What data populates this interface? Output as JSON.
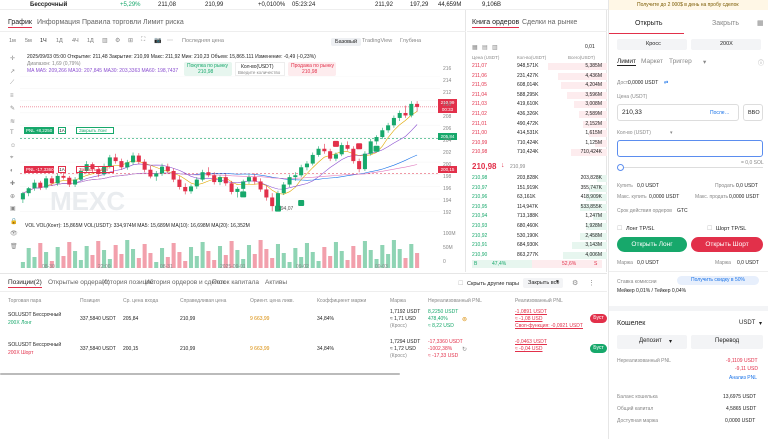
{
  "topbar": {
    "pair": "Бессрочный",
    "pct": "+5,29%",
    "price1": "211,08",
    "price2": "210,99",
    "pct2": "+0,0100%",
    "time": "05:23:24",
    "v1": "211,92",
    "v2": "197,29",
    "v3": "44,659M",
    "v4": "9,106B",
    "promo": "Получите до 2 000$ в день на пробу сделок"
  },
  "chart": {
    "tabs": [
      "График",
      "Информация",
      "Правила торговли",
      "Лимит риска"
    ],
    "intervals": [
      "1м",
      "5м",
      "1Ч",
      "1Д",
      "4Ч",
      "1Д"
    ],
    "depth_label": "Последняя цена",
    "views": [
      "Базовый",
      "TradingView",
      "Глубина"
    ],
    "ohlc": "2025/09/03 05:00  Открытие: 211,48  Закрытие: 210,99  Макс: 211,92  Мин: 210,23  Объем: 15,865.111  Изменение: -0,49 (-0,23%)",
    "range": "Диапазон: 1,69 (0,79%)",
    "ma": "MA  MA5: 209,266  MA10: 207,845  MA30: 203,3363  MA60: 198,7437",
    "buy_market": "Покупка по рынку",
    "qty": "Кол-во(USDT)",
    "qty_ph": "Введите количество",
    "sell_market": "Продажа по рынку",
    "buy_price": "210,98",
    "sell_price": "210,98",
    "pnl_long": "PNL +8,2250",
    "lots_long": "1A",
    "close_long": "Закрыть Лонг",
    "pnl_short": "PNL -17,3360",
    "close_short": "Закрыть Шорт",
    "watermark": "MEXC",
    "low_label": "194,07",
    "vol": "VOL  VOL(Конт): 15,865M  VOL(USDT): 334,974M  MA5: 15,689M  MA(10): 16,698M  MA(20): 16,352M",
    "x_ticks": [
      "08-30",
      "22:00",
      "08-31",
      "2025-09-01",
      "09-02",
      "09-03"
    ],
    "y_ticks": [
      "216",
      "214",
      "212",
      "210",
      "208",
      "206",
      "204",
      "202",
      "200",
      "198",
      "196",
      "194",
      "192"
    ],
    "price_tag": "210,99",
    "price_tag2": "00:33",
    "tag_green": "205,84",
    "tag_red": "200,15",
    "vol_ticks": [
      "100M",
      "50M",
      "0"
    ]
  },
  "chart_data": {
    "type": "candlestick",
    "candles": [
      [
        196,
        197.2,
        195.4,
        197
      ],
      [
        197,
        198,
        196.5,
        197.8
      ],
      [
        197.8,
        199.2,
        197.4,
        198.7
      ],
      [
        198.7,
        199,
        197.5,
        197.9
      ],
      [
        197.9,
        199.8,
        197.6,
        199.4
      ],
      [
        199.4,
        199.8,
        198.2,
        198.6
      ],
      [
        198.6,
        200.2,
        198.2,
        199.8
      ],
      [
        199.8,
        200.4,
        199.2,
        199.5
      ],
      [
        199.5,
        199.8,
        198,
        198.4
      ],
      [
        198.4,
        199.6,
        198,
        199.2
      ],
      [
        199.2,
        201,
        199,
        200.6
      ],
      [
        200.6,
        202.2,
        200.2,
        201.7
      ],
      [
        201.7,
        202,
        200.4,
        200.9
      ],
      [
        200.9,
        201.4,
        199.6,
        200.1
      ],
      [
        200.1,
        201.8,
        199.8,
        201.4
      ],
      [
        201.4,
        203.2,
        201,
        202.8
      ],
      [
        202.8,
        203.4,
        201.8,
        202.2
      ],
      [
        202.2,
        202.6,
        200.8,
        201.2
      ],
      [
        201.2,
        202.4,
        200.8,
        202
      ],
      [
        202,
        203.6,
        201.6,
        203.1
      ],
      [
        203.1,
        203.5,
        201.7,
        202.1
      ],
      [
        202.1,
        202.5,
        200.4,
        200.8
      ],
      [
        200.8,
        201.4,
        199.4,
        199.7
      ],
      [
        199.7,
        200.6,
        199,
        200.2
      ],
      [
        200.2,
        201.8,
        199.8,
        201.3
      ],
      [
        201.3,
        201.8,
        200.2,
        200.6
      ],
      [
        200.6,
        201,
        198.8,
        199.2
      ],
      [
        199.2,
        199.8,
        197.6,
        198
      ],
      [
        198,
        198.6,
        196.8,
        197.3
      ],
      [
        197.3,
        198.4,
        196.9,
        198.1
      ],
      [
        198.1,
        199.6,
        197.7,
        199.2
      ],
      [
        199.2,
        200.8,
        198.9,
        200.4
      ],
      [
        200.4,
        201.2,
        199.6,
        199.9
      ],
      [
        199.9,
        200.4,
        198.4,
        198.8
      ],
      [
        198.8,
        199.9,
        198.3,
        199.6
      ],
      [
        199.6,
        200.1,
        198.2,
        198.6
      ],
      [
        198.6,
        199,
        196.8,
        197.2
      ],
      [
        197.2,
        198,
        196.3,
        197.7
      ],
      [
        197.7,
        199.2,
        197.3,
        198.9
      ],
      [
        198.9,
        200,
        198.5,
        199.6
      ],
      [
        199.6,
        200.2,
        198.4,
        198.9
      ],
      [
        198.9,
        199.4,
        197.2,
        197.6
      ],
      [
        197.6,
        198.2,
        195.8,
        196.3
      ],
      [
        196.3,
        197,
        194.07,
        194.9
      ],
      [
        194.9,
        197.4,
        194.5,
        197
      ],
      [
        197,
        198.8,
        196.7,
        198.4
      ],
      [
        198.4,
        200,
        198,
        199.6
      ],
      [
        199.6,
        200.4,
        199,
        199.9
      ],
      [
        199.9,
        201.6,
        199.6,
        201.2
      ],
      [
        201.2,
        202.2,
        200.7,
        201.8
      ],
      [
        201.8,
        203.6,
        201.5,
        203.2
      ],
      [
        203.2,
        204.6,
        202.9,
        204.2
      ],
      [
        204.2,
        205,
        203.4,
        203.8
      ],
      [
        203.8,
        204.2,
        202.2,
        202.6
      ],
      [
        202.6,
        203.6,
        202.2,
        203.3
      ],
      [
        203.3,
        205.2,
        203,
        204.8
      ],
      [
        204.8,
        205.4,
        203.9,
        204.2
      ],
      [
        204.2,
        204.6,
        201.8,
        202.2
      ],
      [
        202.2,
        202.6,
        200.4,
        200.9
      ],
      [
        200.9,
        203.8,
        200.6,
        203.4
      ],
      [
        203.4,
        205.8,
        203.1,
        205.4
      ],
      [
        205.4,
        206.4,
        204.9,
        206.1
      ],
      [
        206.1,
        207.6,
        205.8,
        207.2
      ],
      [
        207.2,
        208.4,
        206.8,
        208
      ],
      [
        208,
        209.6,
        207.6,
        209.2
      ],
      [
        209.2,
        210.4,
        208.7,
        210
      ],
      [
        210,
        211.2,
        209.2,
        209.6
      ],
      [
        209.6,
        211.92,
        209.3,
        211.48
      ],
      [
        211.48,
        211.92,
        210.23,
        210.99
      ]
    ],
    "y_range": [
      192,
      216
    ],
    "x_labels": [
      "08-30",
      "22:00",
      "08-31",
      "2025-09-01",
      "09-02",
      "09-03"
    ],
    "volume_axis_range": [
      0,
      100
    ]
  },
  "orderbook": {
    "tabs": [
      "Книга ордеров",
      "Сделки на рынке"
    ],
    "headers": [
      "Цена (USDT)",
      "Кол-во(USDT)",
      "Всего(USDT)"
    ],
    "asks": [
      [
        "211,07",
        "948,571K",
        "5,385M"
      ],
      [
        "211,06",
        "231,427K",
        "4,436M"
      ],
      [
        "211,05",
        "608,014K",
        "4,204M"
      ],
      [
        "211,04",
        "588,295K",
        "3,596M"
      ],
      [
        "211,03",
        "419,610K",
        "3,008M"
      ],
      [
        "211,02",
        "436,326K",
        "2,589M"
      ],
      [
        "211,01",
        "490,472K",
        "2,152M"
      ],
      [
        "211,00",
        "414,531K",
        "1,615M"
      ],
      [
        "210,99",
        "710,424K",
        "1,125M"
      ],
      [
        "210,98",
        "710,424K",
        "710,424K"
      ]
    ],
    "last": "210,98",
    "last_arrow": "↓",
    "mark": "210,99",
    "bids": [
      [
        "210,98",
        "203,828K",
        "203,828K"
      ],
      [
        "210,97",
        "151,919K",
        "355,747K"
      ],
      [
        "210,96",
        "63,161K",
        "418,909K"
      ],
      [
        "210,95",
        "114,947K",
        "533,855K"
      ],
      [
        "210,94",
        "713,188K",
        "1,247M"
      ],
      [
        "210,93",
        "680,460K",
        "1,928M"
      ],
      [
        "210,92",
        "530,190K",
        "2,458M"
      ],
      [
        "210,91",
        "684,930K",
        "3,143M"
      ],
      [
        "210,90",
        "863,277K",
        "4,006M"
      ]
    ],
    "buy_pct": "47,4%",
    "sell_pct": "52,6%",
    "tick_size": "0,01",
    "b_label": "B",
    "s_label": "S"
  },
  "trade": {
    "promo": "Получите до 2 000$ в день на пробу сделок",
    "open": "Открыть",
    "close": "Закрыть",
    "margin_mode": "Кросс",
    "leverage": "200X",
    "order_tabs": [
      "Лимит",
      "Маркет",
      "Триггер"
    ],
    "avail_label": "Дост.",
    "avail_value": "0,0000 USDT",
    "price_label": "Цена (USDT)",
    "price_value": "210,33",
    "last_btn": "После…",
    "bbo": "BBO",
    "qty_label": "Кол-во (USDT)",
    "qty_hint": "= 0,0 SOL",
    "buy_label": "Купить",
    "buy_val": "0,0 USDT",
    "sell_label": "Продать",
    "sell_val": "0,0 USDT",
    "max_buy": "Макс. купить",
    "max_buy_val": "0,0000 USDT",
    "max_sell": "Макс. продать",
    "max_sell_val": "0,0000 USDT",
    "tif": "Срок действия ордеров",
    "tif_val": "GTC",
    "long_tpsl": "Лонг TP/SL",
    "short_tpsl": "Шорт TP/SL",
    "open_long": "Открыть Лонг",
    "open_short": "Открыть Шорт",
    "margin_l": "Маржа",
    "margin_l_val": "0,0 USDT",
    "margin_s": "Маржа",
    "margin_s_val": "0,0 USDT",
    "fee_label": "Ставка комиссии",
    "fee_promo": "Получить скидку в 50%",
    "fee_val": "Мейкер 0,01% / Тейкер 0,04%",
    "wallet": "Кошелек",
    "wallet_cur": "USDT",
    "deposit": "Депозит",
    "transfer": "Перевод",
    "upnl": "Нереализованный PNL",
    "upnl_v1": "-9,1109 USDT",
    "upnl_v2": "-9,11 USD",
    "analysis": "Анализ PNL",
    "wallet_bal": "Баланс кошелька",
    "wallet_bal_v": "13,6975 USDT",
    "total_cap": "Общий капитал",
    "total_cap_v": "4,5865 USDT",
    "avail_m": "Доступная маржа",
    "avail_m_v": "0,0000 USDT"
  },
  "positions": {
    "tabs": [
      "Позиции(2)",
      "Открытые ордера(0)",
      "История позиций",
      "История ордеров и сделок",
      "Поток капитала",
      "Активы"
    ],
    "hide_others": "Скрыть другие пары",
    "close_all": "Закрыть все",
    "headers": [
      "Торговая пара",
      "Позиция",
      "Ср. цена входа",
      "Справедливая цена",
      "Ориент. цена ликв.",
      "Коэффициент маржи",
      "Маржа",
      "Нереализованный PNL",
      "Реализованный PNL"
    ],
    "rows": [
      {
        "pair": "SOLUSDT  Бессрочный",
        "sub": "200X Лонг",
        "pos": "337,5840 USDT",
        "entry": "205,84",
        "fair": "210,99",
        "liq": "9 663,99",
        "ratio": "34,84%",
        "margin1": "1,7192 USDT",
        "margin2": "≈ 1,71 USD",
        "margin3": "(Кросс)",
        "upnl1": "8,2250 USDT",
        "upnl2": "478,40%",
        "upnl3": "≈ 8,22 USD",
        "rpnl1": "-1,0891 USDT",
        "rpnl2": "≈ -1,08 USD",
        "rpnl3": "Своп-функция: -0,0921 USDT",
        "btn": "Буст"
      },
      {
        "pair": "SOLUSDT  Бессрочный",
        "sub": "200X Шорт",
        "pos": "337,5840 USDT",
        "entry": "200,15",
        "fair": "210,99",
        "liq": "9 663,99",
        "ratio": "34,84%",
        "margin1": "1,7294 USDT",
        "margin2": "≈ 1,72 USD",
        "margin3": "(Кросс)",
        "upnl1": "-17,3360 USDT",
        "upnl2": "-1002,38%",
        "upnl3": "≈ -17,33 USD",
        "rpnl1": "-0,0463 USDT",
        "rpnl2": "≈ -0,04 USD",
        "rpnl3": "",
        "btn": "Буст"
      }
    ]
  }
}
